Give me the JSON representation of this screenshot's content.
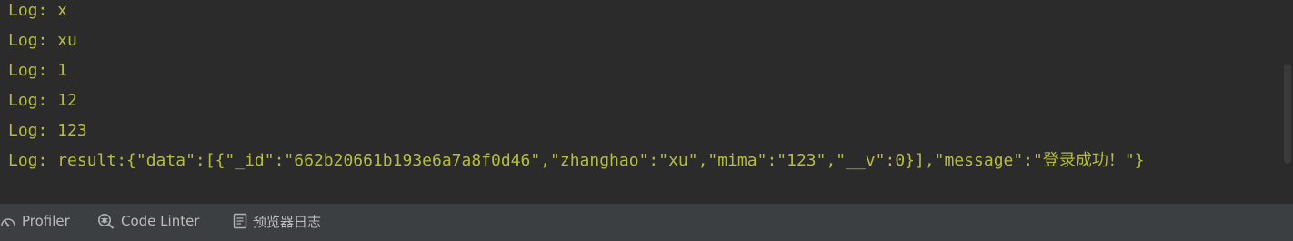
{
  "console": {
    "lines": [
      "Log: x",
      "Log: xu",
      "Log: 1",
      "Log: 12",
      "Log: 123",
      "Log: result:{\"data\":[{\"_id\":\"662b20661b193e6a7a8f0d46\",\"zhanghao\":\"xu\",\"mima\":\"123\",\"__v\":0}],\"message\":\"登录成功！\"}"
    ]
  },
  "toolbar": {
    "tabs": [
      {
        "label": "Profiler",
        "icon": "gauge-icon"
      },
      {
        "label": "Code Linter",
        "icon": "magnifier-bug-icon"
      },
      {
        "label": "预览器日志",
        "icon": "document-log-icon"
      }
    ]
  },
  "colors": {
    "console_bg": "#2b2b2b",
    "log_text": "#b5bd3f",
    "toolbar_bg": "#3c3f41",
    "toolbar_text": "#bbbbbb"
  }
}
